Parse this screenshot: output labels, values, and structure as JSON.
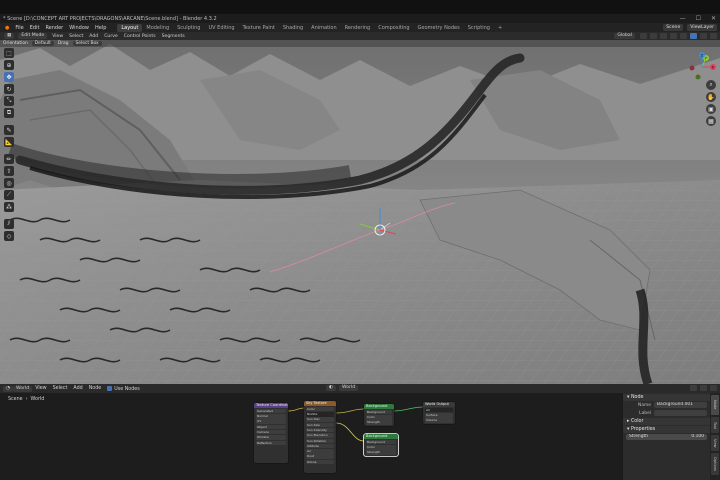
{
  "window": {
    "title": "* Scene [D:\\CONCEPT ART PROJECTS\\DRAGONS\\ARCANE\\Scene.blend] - Blender 4.3.2",
    "controls": [
      "—",
      "☐",
      "✕"
    ]
  },
  "menubar": {
    "menus": [
      "File",
      "Edit",
      "Render",
      "Window",
      "Help"
    ],
    "workspaces": [
      "Layout",
      "Modeling",
      "Sculpting",
      "UV Editing",
      "Texture Paint",
      "Shading",
      "Animation",
      "Rendering",
      "Compositing",
      "Geometry Nodes",
      "Scripting"
    ],
    "active_workspace": "Layout",
    "scene_field": "Scene",
    "view_layer_field": "ViewLayer"
  },
  "viewport_header": {
    "mode": "Edit Mode",
    "menus": [
      "View",
      "Select",
      "Add",
      "Curve",
      "Control Points",
      "Segments"
    ],
    "transform": "Global"
  },
  "tool_settings": {
    "orientation_label": "Orientation",
    "orientation_value": "Default",
    "drag_label": "Drag",
    "drag_value": "Select Box"
  },
  "toolbar": {
    "tools": [
      {
        "name": "select-box-tool",
        "glyph": "⬚"
      },
      {
        "name": "cursor-tool",
        "glyph": "⊕"
      },
      {
        "name": "move-tool",
        "glyph": "✥",
        "active": true
      },
      {
        "name": "rotate-tool",
        "glyph": "↻"
      },
      {
        "name": "scale-tool",
        "glyph": "⤡"
      },
      {
        "name": "transform-tool",
        "glyph": "⧉"
      },
      {
        "name": "annotate-tool",
        "glyph": "✎"
      },
      {
        "name": "measure-tool",
        "glyph": "📐"
      },
      {
        "name": "draw-tool",
        "glyph": "✏"
      },
      {
        "name": "extrude-tool",
        "glyph": "⇧"
      },
      {
        "name": "radius-tool",
        "glyph": "◎"
      },
      {
        "name": "tilt-tool",
        "glyph": "⟋"
      },
      {
        "name": "randomize-tool",
        "glyph": "⁂"
      },
      {
        "name": "shear-tool",
        "glyph": "⫽"
      },
      {
        "name": "fin-tool",
        "glyph": "◇"
      }
    ]
  },
  "gizmo": {
    "axes": {
      "x": "X",
      "y": "Y",
      "z": "Z"
    },
    "colors": {
      "x": "#e0415c",
      "y": "#8cc63f",
      "z": "#3e8ddb"
    }
  },
  "node_editor": {
    "header": {
      "editor_type": "World",
      "menus": [
        "View",
        "Select",
        "Add",
        "Node"
      ],
      "use_nodes": "Use Nodes",
      "slot": "World"
    },
    "breadcrumb": [
      "Scene",
      "›",
      "World"
    ],
    "nodes": {
      "texcoord": {
        "title": "Texture Coordinate",
        "rows": [
          "Generated",
          "Normal",
          "UV",
          "Object",
          "Camera",
          "Window",
          "Reflection"
        ]
      },
      "sky": {
        "title": "Sky Texture",
        "rows": [
          "Color",
          "Nishita",
          "Sun Disc",
          "Sun Size",
          "Sun Intensity",
          "Sun Elevation",
          "Sun Rotation",
          "Altitude",
          "Air",
          "Dust",
          "Ozone"
        ]
      },
      "background1": {
        "title": "Background",
        "rows": [
          "Background",
          "Color",
          "Strength"
        ]
      },
      "background2": {
        "title": "Background",
        "rows": [
          "Background",
          "Color",
          "Strength"
        ]
      },
      "output": {
        "title": "World Output",
        "rows": [
          "All",
          "Surface",
          "Volume"
        ]
      }
    }
  },
  "node_panel": {
    "node_section": "Node",
    "name_label": "Name",
    "name_value": "Background.001",
    "label_label": "Label",
    "label_value": "",
    "color_section": "Color",
    "properties_section": "Properties",
    "strength_label": "Strength",
    "strength_value": "0.100",
    "tabs": [
      "Node",
      "Tool",
      "View",
      "Options"
    ]
  },
  "colors": {
    "accent": "#4672b4",
    "viewport_bg": "#8b8b8b",
    "node_color_header": "#8a5a2b",
    "node_shader_header": "#2e7a3e",
    "node_vector_header": "#5a3e8a"
  }
}
